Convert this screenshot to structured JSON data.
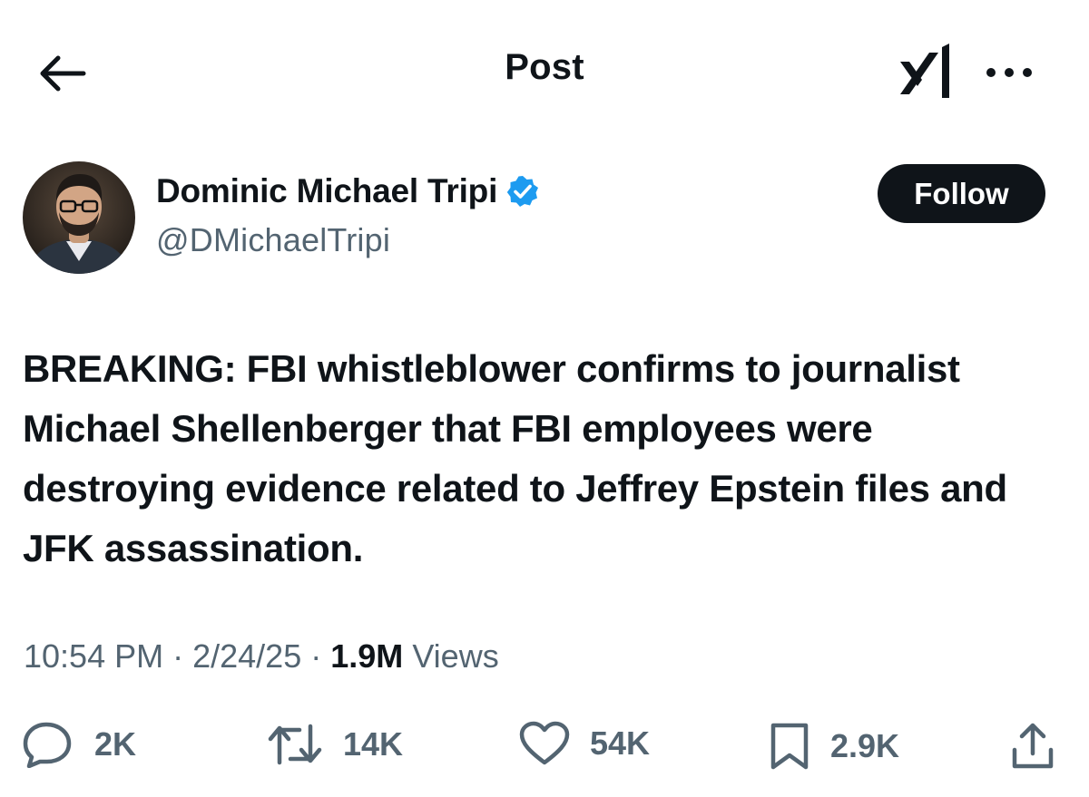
{
  "header": {
    "title": "Post",
    "back_icon": "arrow-left-icon",
    "grok_icon": "grok-logo-icon",
    "more_icon": "more-horizontal-icon"
  },
  "author": {
    "display_name": "Dominic Michael Tripi",
    "handle": "@DMichaelTripi",
    "verified_color": "#1d9bf0",
    "follow_label": "Follow"
  },
  "tweet": {
    "text": "BREAKING: FBI whistleblower confirms to journalist Michael Shellenberger that FBI employees were destroying evidence related to Jeffrey Epstein files and JFK assassination.",
    "time": "10:54 PM",
    "date": "2/24/25",
    "views_count": "1.9M",
    "views_label": "Views"
  },
  "actions": {
    "replies": "2K",
    "reposts": "14K",
    "likes": "54K",
    "bookmarks": "2.9K"
  },
  "colors": {
    "text": "#0f1419",
    "secondary": "#536471",
    "accent": "#1d9bf0"
  }
}
